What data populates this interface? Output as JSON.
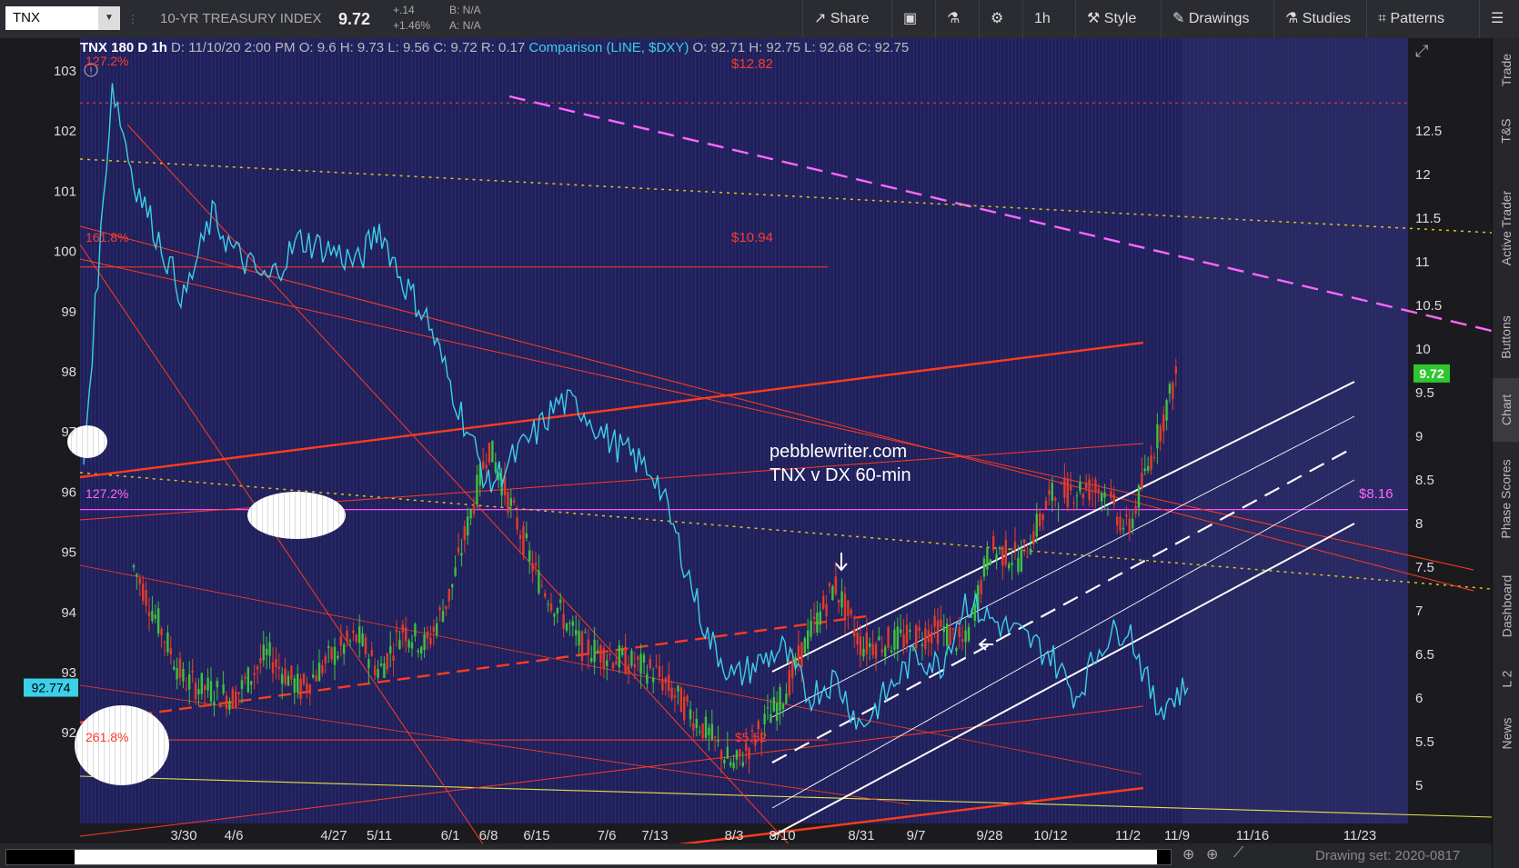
{
  "toolbar": {
    "symbol": "TNX",
    "title": "10-YR TREASURY INDEX",
    "last": "9.72",
    "change": "+.14",
    "change_pct": "+1.46%",
    "bid": "B: N/A",
    "ask": "A: N/A",
    "share": "Share",
    "interval": "1h",
    "style": "Style",
    "drawings": "Drawings",
    "studies": "Studies",
    "patterns": "Patterns"
  },
  "header": {
    "symbol": "TNX 180 D 1h",
    "date": "D: 11/10/20 2:00 PM",
    "open": "O: 9.6",
    "high": "H: 9.73",
    "low": "L: 9.56",
    "close": "C: 9.72",
    "range": "R: 0.17",
    "comparison": "Comparison (LINE, $DXY)",
    "c_open": "O: 92.71",
    "c_high": "H: 92.75",
    "c_low": "L: 92.68",
    "c_close": "C: 92.75"
  },
  "annotations": {
    "fib_127_top": "127.2%",
    "fib_1618": "161.8%",
    "fib_127_mid": "127.2%",
    "fib_2618": "261.8%",
    "price_1282": "$12.82",
    "price_1094": "$10.94",
    "price_816": "$8.16",
    "price_552": "$5.52",
    "watermark1": "pebblewriter.com",
    "watermark2": "TNX v DX 60-min",
    "last_badge": "9.72",
    "left_badge": "92.774"
  },
  "chart_data": {
    "type": "line",
    "title": "TNX 180 D 1h",
    "left_axis": {
      "label": "$DXY",
      "ticks": [
        92,
        93,
        94,
        95,
        96,
        97,
        98,
        99,
        100,
        101,
        102,
        103
      ]
    },
    "right_axis": {
      "label": "TNX",
      "ticks": [
        "5",
        "5.5",
        "6",
        "6.5",
        "7",
        "7.5",
        "8",
        "8.5",
        "9",
        "9.5",
        "10",
        "10.5",
        "11",
        "11.5",
        "12",
        "12.5"
      ]
    },
    "x_ticks": [
      "3/30",
      "4/6",
      "4/27",
      "5/11",
      "6/1",
      "6/8",
      "6/15",
      "7/6",
      "7/13",
      "8/3",
      "8/10",
      "8/31",
      "9/7",
      "9/28",
      "10/12",
      "11/2",
      "11/9",
      "11/16",
      "11/23"
    ],
    "series": [
      {
        "name": "TNX",
        "type": "candlestick",
        "color": "#3ec13e",
        "points": [
          [
            "3/23",
            7.5
          ],
          [
            "3/30",
            6.2
          ],
          [
            "4/6",
            6.0
          ],
          [
            "4/13",
            6.5
          ],
          [
            "4/20",
            6.1
          ],
          [
            "4/27",
            6.5
          ],
          [
            "5/4",
            6.7
          ],
          [
            "5/11",
            6.3
          ],
          [
            "5/18",
            6.8
          ],
          [
            "5/25",
            6.6
          ],
          [
            "6/1",
            7.2
          ],
          [
            "6/8",
            8.9
          ],
          [
            "6/15",
            7.4
          ],
          [
            "6/22",
            7.0
          ],
          [
            "6/29",
            6.6
          ],
          [
            "7/6",
            6.5
          ],
          [
            "7/13",
            6.3
          ],
          [
            "7/20",
            5.95
          ],
          [
            "7/27",
            5.6
          ],
          [
            "8/3",
            5.2
          ],
          [
            "8/10",
            6.0
          ],
          [
            "8/17",
            6.7
          ],
          [
            "8/24",
            7.3
          ],
          [
            "8/31",
            6.6
          ],
          [
            "9/7",
            6.7
          ],
          [
            "9/14",
            6.8
          ],
          [
            "9/21",
            6.6
          ],
          [
            "9/28",
            7.7
          ],
          [
            "10/5",
            7.6
          ],
          [
            "10/12",
            8.3
          ],
          [
            "10/19",
            8.4
          ],
          [
            "10/26",
            8.4
          ],
          [
            "11/2",
            7.9
          ],
          [
            "11/9",
            9.72
          ]
        ]
      },
      {
        "name": "$DXY",
        "type": "line",
        "color": "#3ccfe8",
        "points": [
          [
            "3/16",
            96.5
          ],
          [
            "3/20",
            102.8
          ],
          [
            "3/23",
            101.2
          ],
          [
            "3/30",
            99.2
          ],
          [
            "4/3",
            100.6
          ],
          [
            "4/6",
            100.0
          ],
          [
            "4/13",
            99.5
          ],
          [
            "4/20",
            100.2
          ],
          [
            "4/27",
            100.0
          ],
          [
            "5/4",
            99.8
          ],
          [
            "5/11",
            100.4
          ],
          [
            "5/18",
            99.5
          ],
          [
            "5/25",
            98.9
          ],
          [
            "6/1",
            97.8
          ],
          [
            "6/8",
            96.1
          ],
          [
            "6/15",
            97.0
          ],
          [
            "6/22",
            97.5
          ],
          [
            "6/29",
            97.4
          ],
          [
            "7/6",
            96.9
          ],
          [
            "7/13",
            96.3
          ],
          [
            "7/20",
            95.0
          ],
          [
            "7/27",
            93.6
          ],
          [
            "8/3",
            92.9
          ],
          [
            "8/10",
            93.4
          ],
          [
            "8/17",
            92.6
          ],
          [
            "8/24",
            92.9
          ],
          [
            "8/31",
            92.1
          ],
          [
            "9/7",
            93.3
          ],
          [
            "9/14",
            93.1
          ],
          [
            "9/21",
            94.2
          ],
          [
            "9/28",
            93.9
          ],
          [
            "10/5",
            93.6
          ],
          [
            "10/12",
            93.3
          ],
          [
            "10/19",
            92.6
          ],
          [
            "10/26",
            93.5
          ],
          [
            "11/2",
            93.8
          ],
          [
            "11/6",
            92.4
          ],
          [
            "11/10",
            92.75
          ]
        ]
      }
    ],
    "horizontal_levels": [
      {
        "label": "$12.82",
        "value": 12.82,
        "axis": "right",
        "color": "#ff3b2f",
        "style": "dotted"
      },
      {
        "label": "$10.94",
        "value": 10.94,
        "axis": "right",
        "color": "#ff3b2f",
        "style": "solid"
      },
      {
        "label": "$8.16",
        "value": 8.16,
        "axis": "right",
        "color": "#ff4cff",
        "style": "solid"
      },
      {
        "label": "$5.52",
        "value": 5.52,
        "axis": "right",
        "color": "#ff3b2f",
        "style": "solid"
      }
    ],
    "colors": {
      "plot_bg": "#21215a",
      "candle_up": "#3ec13e",
      "candle_down": "#e23b2a",
      "dxy": "#3ccfe8",
      "channel": "#ffffff",
      "trend": "#ff3b1f",
      "pink_dash": "#ff66ff",
      "yellow_dot": "#e0c21a"
    },
    "grid": false,
    "legend": "none"
  },
  "right_tabs": [
    "Trade",
    "T&S",
    "Active Trader",
    "Buttons",
    "Chart",
    "Phase Scores",
    "Dashboard",
    "L 2",
    "News"
  ],
  "bottom": {
    "drawing_set": "Drawing set: 2020-0817"
  }
}
